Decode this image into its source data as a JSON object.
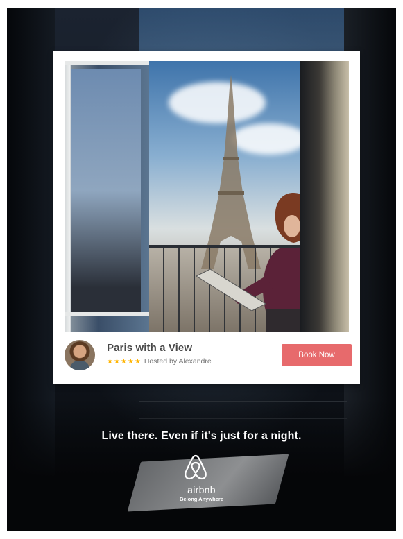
{
  "card": {
    "title": "Paris with a View",
    "rating_stars": "★★★★★",
    "host": "Hosted by Alexandre",
    "book_label": "Book Now"
  },
  "tagline": "Live there. Even if it's just for a night.",
  "brand": {
    "name": "airbnb",
    "motto": "Belong Anywhere"
  },
  "colors": {
    "accent": "#e76a6c",
    "star": "#ffb400",
    "title_text": "#484848"
  },
  "icons": {
    "logo": "airbnb-belo-icon",
    "avatar": "host-avatar"
  }
}
